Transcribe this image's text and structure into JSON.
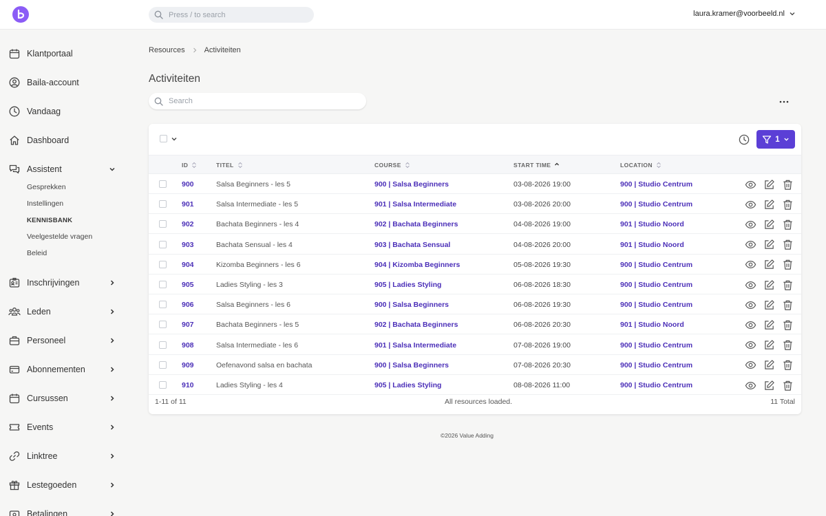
{
  "header": {
    "search_placeholder": "Press / to search",
    "user_email": "laura.kramer@voorbeeld.nl"
  },
  "colors": {
    "accent": "#5b3fd6",
    "link": "#4b2fb8",
    "logo": "#8b5cf6"
  },
  "sidebar": {
    "items": [
      {
        "label": "Klantportaal",
        "icon": "calendar-icon"
      },
      {
        "label": "Baila-account",
        "icon": "user-circle-icon"
      },
      {
        "label": "Vandaag",
        "icon": "clock-icon"
      },
      {
        "label": "Dashboard",
        "icon": "home-icon"
      },
      {
        "label": "Assistent",
        "icon": "chat-icon"
      },
      {
        "label": "Inschrijvingen",
        "icon": "id-card-icon"
      },
      {
        "label": "Leden",
        "icon": "users-icon"
      },
      {
        "label": "Personeel",
        "icon": "briefcase-icon"
      },
      {
        "label": "Abonnementen",
        "icon": "credit-card-icon"
      },
      {
        "label": "Cursussen",
        "icon": "calendar-icon"
      },
      {
        "label": "Events",
        "icon": "ticket-icon"
      },
      {
        "label": "Linktree",
        "icon": "link-icon"
      },
      {
        "label": "Lestegoeden",
        "icon": "gift-icon"
      },
      {
        "label": "Betalingen",
        "icon": "wallet-icon"
      }
    ],
    "assistent_sub": [
      "Gesprekken",
      "Instellingen",
      "KENNISBANK",
      "Veelgestelde vragen",
      "Beleid"
    ]
  },
  "breadcrumb": {
    "root": "Resources",
    "current": "Activiteiten"
  },
  "page": {
    "title": "Activiteiten",
    "search_placeholder": "Search",
    "filter_count": "1"
  },
  "table": {
    "columns": {
      "id": "ID",
      "title": "TITEL",
      "course": "COURSE",
      "start": "START TIME",
      "location": "LOCATION"
    },
    "rows": [
      {
        "id": "900",
        "title": "Salsa Beginners - les 5",
        "course": "900 | Salsa Beginners",
        "start": "03-08-2026 19:00",
        "location": "900 | Studio Centrum"
      },
      {
        "id": "901",
        "title": "Salsa Intermediate - les 5",
        "course": "901 | Salsa Intermediate",
        "start": "03-08-2026 20:00",
        "location": "900 | Studio Centrum"
      },
      {
        "id": "902",
        "title": "Bachata Beginners - les 4",
        "course": "902 | Bachata Beginners",
        "start": "04-08-2026 19:00",
        "location": "901 | Studio Noord"
      },
      {
        "id": "903",
        "title": "Bachata Sensual - les 4",
        "course": "903 | Bachata Sensual",
        "start": "04-08-2026 20:00",
        "location": "901 | Studio Noord"
      },
      {
        "id": "904",
        "title": "Kizomba Beginners - les 6",
        "course": "904 | Kizomba Beginners",
        "start": "05-08-2026 19:30",
        "location": "900 | Studio Centrum"
      },
      {
        "id": "905",
        "title": "Ladies Styling - les 3",
        "course": "905 | Ladies Styling",
        "start": "06-08-2026 18:30",
        "location": "900 | Studio Centrum"
      },
      {
        "id": "906",
        "title": "Salsa Beginners - les 6",
        "course": "900 | Salsa Beginners",
        "start": "06-08-2026 19:30",
        "location": "900 | Studio Centrum"
      },
      {
        "id": "907",
        "title": "Bachata Beginners - les 5",
        "course": "902 | Bachata Beginners",
        "start": "06-08-2026 20:30",
        "location": "901 | Studio Noord"
      },
      {
        "id": "908",
        "title": "Salsa Intermediate - les 6",
        "course": "901 | Salsa Intermediate",
        "start": "07-08-2026 19:00",
        "location": "900 | Studio Centrum"
      },
      {
        "id": "909",
        "title": "Oefenavond salsa en bachata",
        "course": "900 | Salsa Beginners",
        "start": "07-08-2026 20:30",
        "location": "900 | Studio Centrum"
      },
      {
        "id": "910",
        "title": "Ladies Styling - les 4",
        "course": "905 | Ladies Styling",
        "start": "08-08-2026 11:00",
        "location": "900 | Studio Centrum"
      }
    ],
    "footer": {
      "range": "1-11 of 11",
      "status": "All resources loaded.",
      "total": "11 Total"
    }
  },
  "footer": {
    "copyright": "©2026 Value Adding"
  }
}
